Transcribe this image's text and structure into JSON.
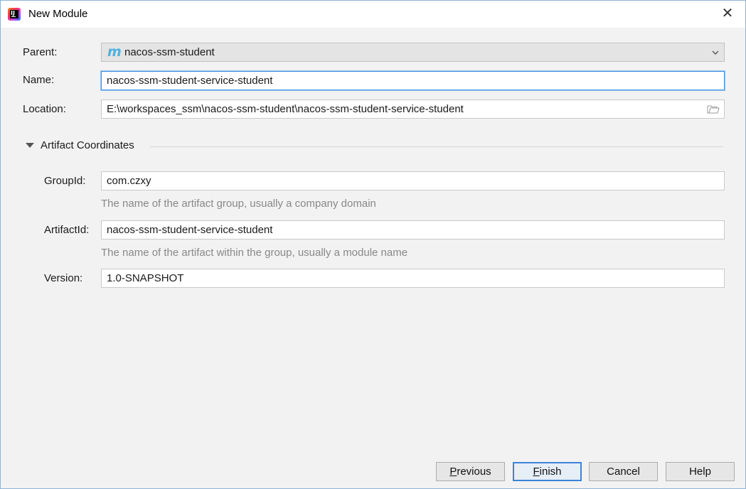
{
  "window": {
    "title": "New Module",
    "close_glyph": "✕",
    "app_icon_glyph": "IJ"
  },
  "form": {
    "parent_label": "Parent:",
    "parent_value": "nacos-ssm-student",
    "parent_icon_glyph": "m",
    "name_label": "Name:",
    "name_value": "nacos-ssm-student-service-student",
    "location_label": "Location:",
    "location_value": "E:\\workspaces_ssm\\nacos-ssm-student\\nacos-ssm-student-service-student"
  },
  "artifact": {
    "section_title": "Artifact Coordinates",
    "group_label": "GroupId:",
    "group_value": "com.czxy",
    "group_hint": "The name of the artifact group, usually a company domain",
    "artifact_label": "ArtifactId:",
    "artifact_value": "nacos-ssm-student-service-student",
    "artifact_hint": "The name of the artifact within the group, usually a module name",
    "version_label": "Version:",
    "version_value": "1.0-SNAPSHOT"
  },
  "buttons": {
    "previous_mnemonic": "P",
    "previous_rest": "revious",
    "finish_mnemonic": "F",
    "finish_rest": "inish",
    "cancel": "Cancel",
    "help": "Help"
  },
  "colors": {
    "focus_border": "#3d8ee0",
    "maven_icon": "#4cb3e0",
    "default_button_border": "#3b83d8",
    "hint_text": "#888888"
  }
}
